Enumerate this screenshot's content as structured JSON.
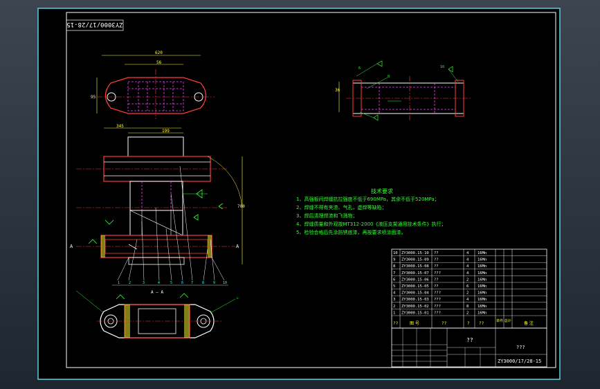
{
  "drawing": {
    "number": "ZY3000/17/28-15",
    "number_mirrored": "ZY3000/17/28-15",
    "title_unknown": "??",
    "title_main": "???",
    "section_label": "A — A",
    "section_mark": "A"
  },
  "notes": {
    "heading": "技术要求",
    "items": [
      "1、高强板间焊缝抗拉强度不低于690MPa，其余不低于520MPa；",
      "2、焊缝不得有夹渣、气孔，虚焊等缺陷；",
      "3、焊后清理焊渣和飞溅物；",
      "4、焊缝质量和外观按MT312-2000《液压支架通用技术条件》执行；",
      "5、检验合格后先涂防锈底漆，再按要求喷涂面漆。"
    ]
  },
  "bom": {
    "rows": [
      {
        "no": "10",
        "code": "ZY3000.15-10",
        "name": "??",
        "qty": "4",
        "mat": "16Mn"
      },
      {
        "no": "9",
        "code": "ZY3000.15-09",
        "name": "??",
        "qty": "4",
        "mat": "16Mn"
      },
      {
        "no": "8",
        "code": "ZY3000.15-08",
        "name": "??",
        "qty": "4",
        "mat": "16Mn"
      },
      {
        "no": "7",
        "code": "ZY3000.15-07",
        "name": "???",
        "qty": "4",
        "mat": "16Mn"
      },
      {
        "no": "6",
        "code": "ZY3000.15-06",
        "name": "??",
        "qty": "2",
        "mat": "16Mn"
      },
      {
        "no": "5",
        "code": "ZY3000.15-05",
        "name": "??",
        "qty": "6",
        "mat": "16Mn"
      },
      {
        "no": "4",
        "code": "ZY3000.15-04",
        "name": "???",
        "qty": "2",
        "mat": "16Mn"
      },
      {
        "no": "3",
        "code": "ZY3000.15-03",
        "name": "???",
        "qty": "4",
        "mat": "16Mn"
      },
      {
        "no": "2",
        "code": "ZY3000.15-02",
        "name": "???",
        "qty": "8",
        "mat": "16Mn"
      },
      {
        "no": "1",
        "code": "ZY3000.15-01",
        "name": "???",
        "qty": "2",
        "mat": "16Mn"
      }
    ],
    "header": {
      "no": "??",
      "code": "图 号",
      "name": "??",
      "qty": "?",
      "mat": "??",
      "weight": "单件 总计",
      "note": "备 注"
    }
  },
  "dims": {
    "top_width": "620",
    "top_inner": "56",
    "top_height": "95",
    "mid_w1": "345",
    "mid_w2": "199",
    "height_total": "700",
    "right_len": "36",
    "weld1": "6",
    "weld2": "8",
    "weld3": "10"
  },
  "callouts": [
    "1",
    "2",
    "3",
    "4",
    "5",
    "6",
    "7",
    "8",
    "9",
    "10"
  ],
  "colors": {
    "background": "#000000",
    "frame": "#ffffff",
    "part_red": "#ff3b3b",
    "hidden_magenta": "#ff3cff",
    "dimension": "#ffff33",
    "outline": "#ffffff",
    "weld_green": "#33ff33",
    "text_green": "#33ff33",
    "text_yellow": "#ffff33",
    "callout_cyan": "#33ffff"
  }
}
